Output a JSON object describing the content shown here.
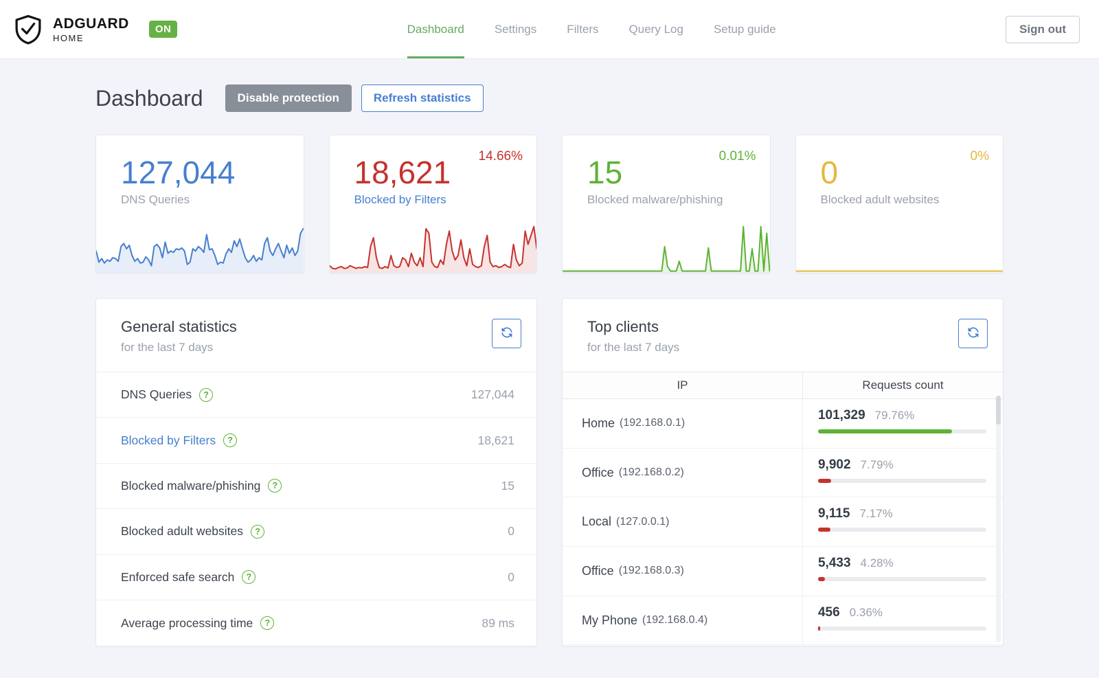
{
  "header": {
    "brand": {
      "name": "ADGUARD",
      "sub": "HOME",
      "status": "ON",
      "status_color": "#66b144"
    },
    "nav": {
      "dashboard": "Dashboard",
      "settings": "Settings",
      "filters": "Filters",
      "query_log": "Query Log",
      "setup_guide": "Setup guide",
      "active": "Dashboard",
      "active_color": "#67a962"
    },
    "signout_label": "Sign out"
  },
  "page": {
    "title": "Dashboard",
    "disable_button": "Disable protection",
    "refresh_button": "Refresh statistics"
  },
  "cards": [
    {
      "value": "127,044",
      "pct": "",
      "label": "DNS Queries",
      "color": "#467fcf",
      "label_color": "#9aa0ac",
      "spark": [
        0.45,
        0.2,
        0.28,
        0.18,
        0.25,
        0.22,
        0.3,
        0.28,
        0.22,
        0.55,
        0.62,
        0.5,
        0.58,
        0.35,
        0.22,
        0.28,
        0.18,
        0.2,
        0.32,
        0.25,
        0.12,
        0.55,
        0.6,
        0.52,
        0.3,
        0.65,
        0.4,
        0.45,
        0.42,
        0.5,
        0.48,
        0.52,
        0.45,
        0.15,
        0.2,
        0.5,
        0.45,
        0.55,
        0.5,
        0.42,
        0.82,
        0.48,
        0.5,
        0.35,
        0.15,
        0.2,
        0.18,
        0.38,
        0.5,
        0.42,
        0.68,
        0.55,
        0.72,
        0.5,
        0.3,
        0.2,
        0.25,
        0.35,
        0.22,
        0.3,
        0.25,
        0.62,
        0.75,
        0.45,
        0.35,
        0.5,
        0.62,
        0.45,
        0.3,
        0.58,
        0.4,
        0.52,
        0.35,
        0.45,
        0.85,
        0.95
      ]
    },
    {
      "value": "18,621",
      "pct": "14.66%",
      "label": "Blocked by Filters",
      "color": "#c5322d",
      "label_color": "#467fcf",
      "spark": [
        0.12,
        0.06,
        0.05,
        0.08,
        0.1,
        0.06,
        0.07,
        0.12,
        0.09,
        0.06,
        0.08,
        0.07,
        0.1,
        0.08,
        0.55,
        0.75,
        0.3,
        0.08,
        0.06,
        0.1,
        0.07,
        0.35,
        0.12,
        0.08,
        0.1,
        0.3,
        0.25,
        0.1,
        0.4,
        0.2,
        0.12,
        0.3,
        0.1,
        0.95,
        0.85,
        0.2,
        0.1,
        0.08,
        0.25,
        0.15,
        0.6,
        0.9,
        0.45,
        0.25,
        0.35,
        0.7,
        0.3,
        0.12,
        0.5,
        0.15,
        0.1,
        0.08,
        0.12,
        0.55,
        0.8,
        0.2,
        0.1,
        0.12,
        0.08,
        0.1,
        0.15,
        0.1,
        0.08,
        0.6,
        0.25,
        0.12,
        0.18,
        0.9,
        0.6,
        0.8,
        1.0,
        0.5
      ]
    },
    {
      "value": "15",
      "pct": "0.01%",
      "label": "Blocked malware/phishing",
      "color": "#5eb237",
      "label_color": "#9aa0ac",
      "spark": [
        0,
        0,
        0,
        0,
        0,
        0,
        0,
        0,
        0,
        0,
        0,
        0,
        0,
        0,
        0,
        0,
        0,
        0,
        0,
        0,
        0,
        0,
        0,
        0,
        0,
        0,
        0,
        0,
        0,
        0,
        0,
        0,
        0,
        0,
        0,
        0.55,
        0.1,
        0,
        0,
        0,
        0.22,
        0,
        0,
        0,
        0,
        0,
        0,
        0,
        0,
        0,
        0.52,
        0,
        0,
        0,
        0,
        0,
        0,
        0,
        0,
        0,
        0,
        0,
        1.0,
        0,
        0,
        0.5,
        0,
        0,
        1.0,
        0,
        0.85,
        0
      ]
    },
    {
      "value": "0",
      "pct": "0%",
      "label": "Blocked adult websites",
      "color": "#e5b73b",
      "label_color": "#9aa0ac",
      "spark": [
        0,
        0,
        0,
        0,
        0,
        0,
        0,
        0,
        0,
        0
      ]
    }
  ],
  "general": {
    "title": "General statistics",
    "subtitle": "for the last 7 days",
    "rows": [
      {
        "label": "DNS Queries",
        "value": "127,044",
        "label_color": "#3d444e"
      },
      {
        "label": "Blocked by Filters",
        "value": "18,621",
        "label_color": "#467fcf"
      },
      {
        "label": "Blocked malware/phishing",
        "value": "15",
        "label_color": "#3d444e"
      },
      {
        "label": "Blocked adult websites",
        "value": "0",
        "label_color": "#3d444e"
      },
      {
        "label": "Enforced safe search",
        "value": "0",
        "label_color": "#3d444e"
      },
      {
        "label": "Average processing time",
        "value": "89 ms",
        "label_color": "#3d444e"
      }
    ],
    "help_icon": "?"
  },
  "clients": {
    "title": "Top clients",
    "subtitle": "for the last 7 days",
    "columns": {
      "ip": "IP",
      "requests": "Requests count"
    },
    "rows": [
      {
        "name": "Home",
        "ip": "(192.168.0.1)",
        "count": "101,329",
        "pct": "79.76%",
        "pct_value": 79.76,
        "bar_color": "#5eb237"
      },
      {
        "name": "Office",
        "ip": "(192.168.0.2)",
        "count": "9,902",
        "pct": "7.79%",
        "pct_value": 7.79,
        "bar_color": "#c5322d"
      },
      {
        "name": "Local",
        "ip": "(127.0.0.1)",
        "count": "9,115",
        "pct": "7.17%",
        "pct_value": 7.17,
        "bar_color": "#c5322d"
      },
      {
        "name": "Office",
        "ip": "(192.168.0.3)",
        "count": "5,433",
        "pct": "4.28%",
        "pct_value": 4.28,
        "bar_color": "#c5322d"
      },
      {
        "name": "My Phone",
        "ip": "(192.168.0.4)",
        "count": "456",
        "pct": "0.36%",
        "pct_value": 0.36,
        "bar_color": "#c5322d"
      }
    ]
  }
}
